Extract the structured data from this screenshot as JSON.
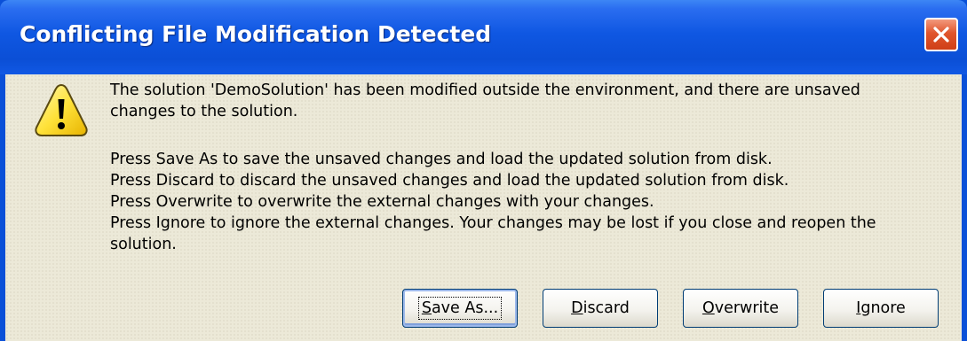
{
  "window": {
    "title": "Conflicting File Modification Detected",
    "close_icon": "close-icon"
  },
  "message": {
    "icon": "warning-icon",
    "line1": "The solution 'DemoSolution' has been modified outside the environment, and there are unsaved",
    "line2": "changes to the solution.",
    "instructions": [
      "Press Save As to save the unsaved changes and load the updated solution from disk.",
      "Press Discard to discard the unsaved changes and load the updated solution from disk.",
      "Press Overwrite to overwrite the external changes with your changes.",
      "Press Ignore to ignore the external changes. Your changes may be lost if you close and reopen the",
      "solution."
    ]
  },
  "buttons": {
    "save_as": {
      "mnemonic": "S",
      "rest": "ave As..."
    },
    "discard": {
      "mnemonic": "D",
      "rest": "iscard"
    },
    "overwrite": {
      "mnemonic": "O",
      "rest": "verwrite"
    },
    "ignore": {
      "mnemonic": "I",
      "rest": "gnore"
    }
  },
  "colors": {
    "titlebar": "#0b4fd6",
    "client_background": "#ece9d8",
    "close_button": "#e0552c"
  }
}
